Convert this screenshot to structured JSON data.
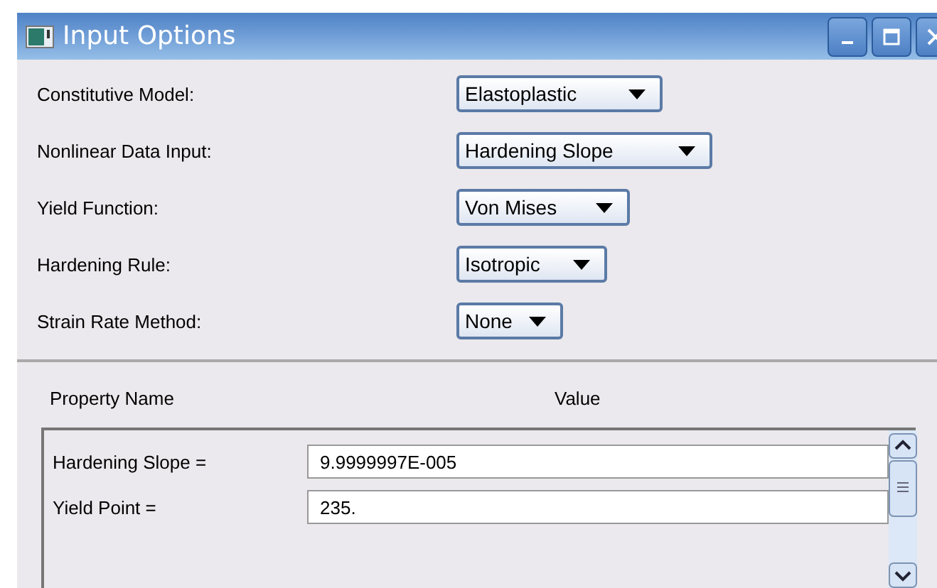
{
  "window": {
    "title": "Input Options"
  },
  "settings": [
    {
      "label": "Constitutive Model:",
      "value": "Elastoplastic"
    },
    {
      "label": "Nonlinear Data Input:",
      "value": "Hardening Slope"
    },
    {
      "label": "Yield Function:",
      "value": "Von Mises"
    },
    {
      "label": "Hardening Rule:",
      "value": "Isotropic"
    },
    {
      "label": "Strain Rate Method:",
      "value": "None"
    }
  ],
  "table": {
    "columns": [
      "Property Name",
      "Value"
    ],
    "rows": [
      {
        "name": "Hardening Slope =",
        "value": "9.9999997E-005"
      },
      {
        "name": "Yield Point =",
        "value": "235."
      }
    ]
  }
}
